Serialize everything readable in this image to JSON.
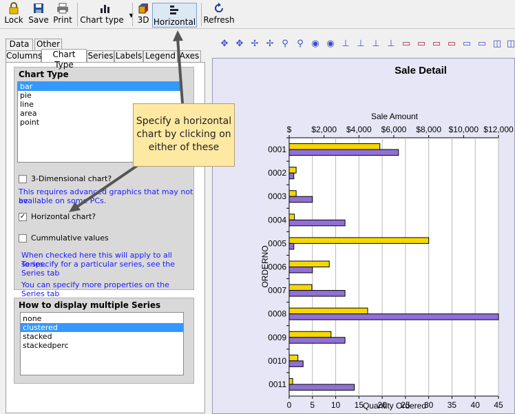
{
  "toolbar": {
    "lock": "Lock",
    "save": "Save",
    "print": "Print",
    "chart_type": "Chart type",
    "three_d": "3D",
    "horizontal": "Horizontal",
    "refresh": "Refresh"
  },
  "tabs_top": [
    "Data",
    "Other"
  ],
  "tabs_bottom": [
    "Columns",
    "Chart Type",
    "Series",
    "Labels",
    "Legend",
    "Axes"
  ],
  "chart_type_panel": {
    "title": "Chart Type",
    "types": [
      "bar",
      "pie",
      "line",
      "area",
      "point"
    ],
    "selected_type": "bar",
    "three_d_label": "3-Dimensional chart?",
    "three_d_note_1": "This requires advanced graphics that may not be",
    "three_d_note_2": "available on some PCs.",
    "horizontal_label": "Horizontal chart?",
    "cumulative_label": "Cummulative values",
    "series_note_1": "When checked here this will apply to all series.",
    "series_note_2": "To specify for a particular series, see the Series tab",
    "series_note_3": "You can specify more properties on the Series tab"
  },
  "multiple_series_panel": {
    "title": "How to display multiple Series",
    "options": [
      "none",
      "clustered",
      "stacked",
      "stackedperc"
    ],
    "selected": "clustered"
  },
  "callout": {
    "line1": "Specify a horizontal",
    "line2": "chart by clicking on",
    "line3": "either of these"
  },
  "colors": {
    "series_amount": "#f5d800",
    "series_quantity": "#9070d8",
    "chart_bg": "#e6e6f6",
    "callout_bg": "#fde9a2"
  },
  "chart_data": {
    "type": "bar",
    "orientation": "horizontal",
    "title": "Sale Detail",
    "top_axis_label": "Sale Amount",
    "top_axis_ticks": [
      "$",
      "$2,000",
      "$4,000",
      "$6,000",
      "$8,000",
      "$10,000",
      "$12,000"
    ],
    "top_axis_range": [
      0,
      12000
    ],
    "bottom_axis_label": "Quantity Ordered",
    "bottom_axis_ticks": [
      "0",
      "5",
      "10",
      "15",
      "20",
      "25",
      "30",
      "35",
      "40",
      "45"
    ],
    "bottom_axis_range": [
      0,
      45
    ],
    "ylabel": "ORDERNO",
    "categories": [
      "0001",
      "0002",
      "0003",
      "0004",
      "0005",
      "0006",
      "0007",
      "0008",
      "0009",
      "0010",
      "0011"
    ],
    "series": [
      {
        "values": [
          5200,
          400,
          400,
          300,
          8000,
          2300,
          1300,
          4500,
          2400,
          500,
          200
        ]
      },
      {
        "values": [
          23.5,
          1,
          5,
          12,
          1,
          5,
          12,
          45,
          12,
          3,
          14
        ]
      }
    ],
    "grid": true
  }
}
